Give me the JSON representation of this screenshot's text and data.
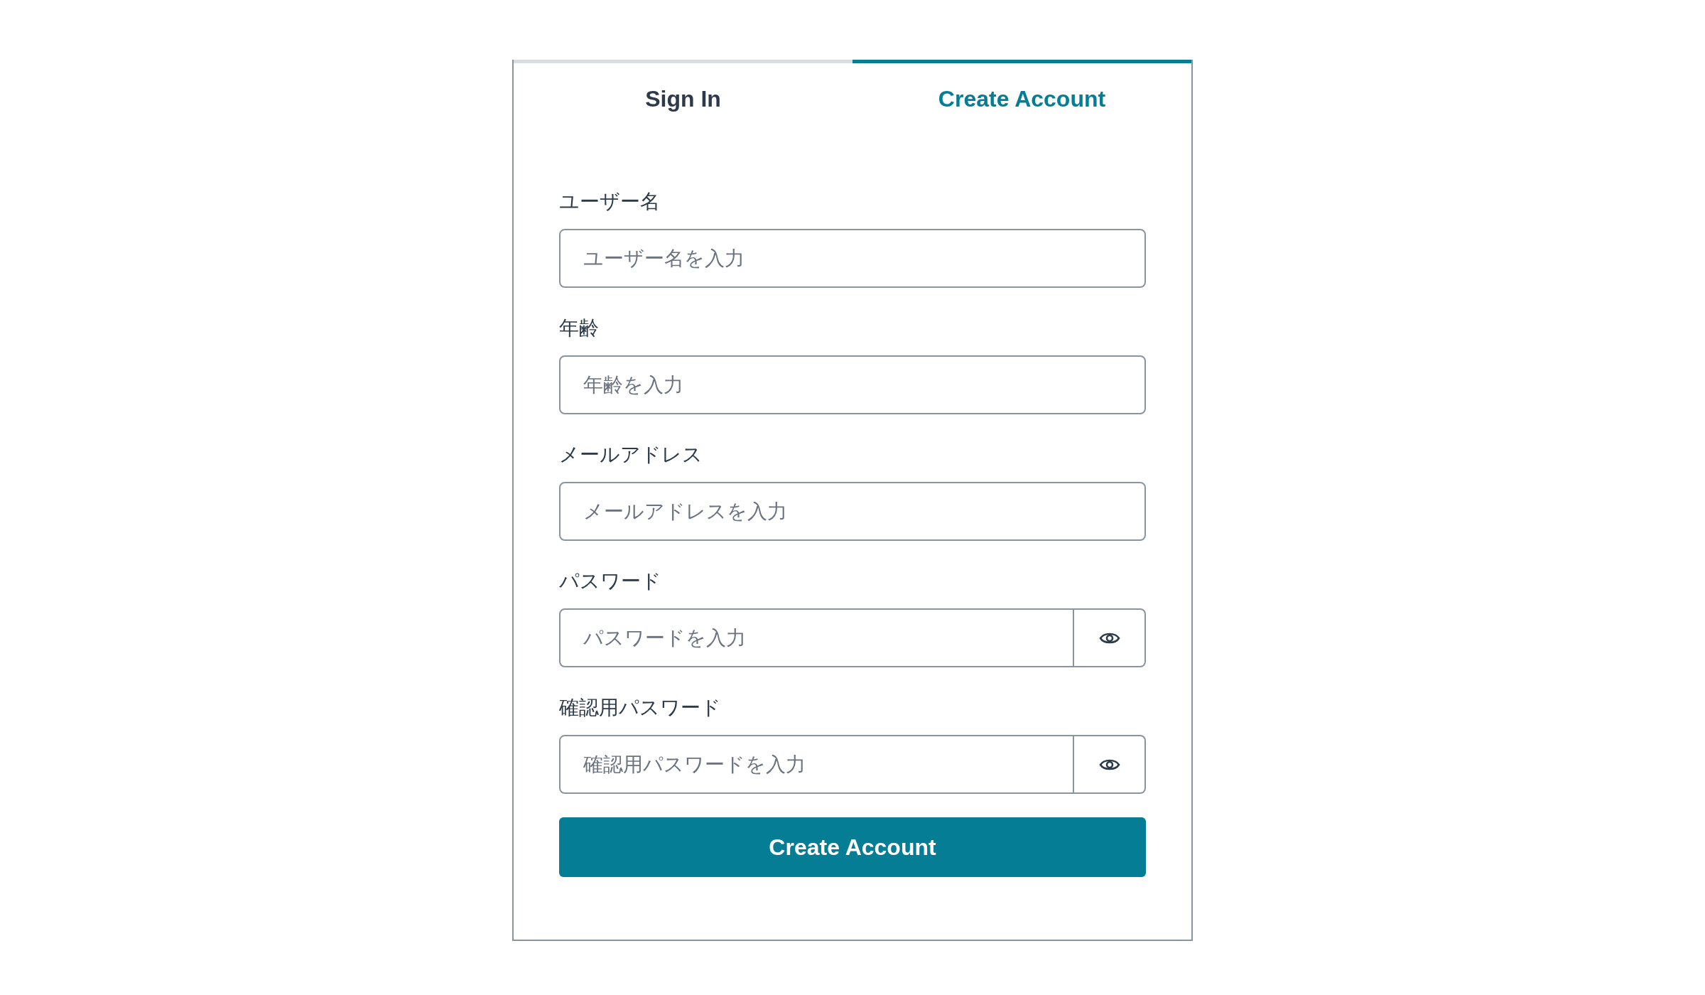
{
  "tabs": [
    {
      "label": "Sign In",
      "selected": false
    },
    {
      "label": "Create Account",
      "selected": true
    }
  ],
  "fields": [
    {
      "kind": "text",
      "label": "ユーザー名",
      "placeholder": "ユーザー名を入力"
    },
    {
      "kind": "text",
      "label": "年齢",
      "placeholder": "年齢を入力"
    },
    {
      "kind": "text",
      "label": "メールアドレス",
      "placeholder": "メールアドレスを入力"
    },
    {
      "kind": "password",
      "label": "パスワード",
      "placeholder": "パスワードを入力"
    },
    {
      "kind": "password",
      "label": "確認用パスワード",
      "placeholder": "確認用パスワードを入力"
    }
  ],
  "submit": {
    "label": "Create Account"
  }
}
